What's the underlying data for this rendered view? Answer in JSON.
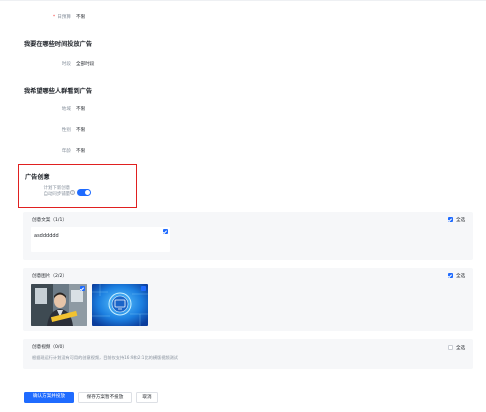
{
  "budget": {
    "label": "日预算",
    "value": "不限"
  },
  "schedule": {
    "title": "我要在哪些时间投放广告",
    "time_label": "时段",
    "time_value": "全部时段"
  },
  "audience": {
    "title": "我希望哪些人群看到广告",
    "region_label": "地域",
    "region_value": "不限",
    "gender_label": "性别",
    "gender_value": "不限",
    "age_label": "年龄",
    "age_value": "不限"
  },
  "creative": {
    "title": "广告创意",
    "sync_label_line1": "计划下新创意",
    "sync_label_line2": "自动同步铺量",
    "help_glyph": "?",
    "sync_enabled": true,
    "icons": {
      "help": "question-circle-icon",
      "toggle": "toggle-switch",
      "checkbox": "checkbox-icon",
      "edit": "edit-icon",
      "image_remove": "remove-icon"
    }
  },
  "copy_card": {
    "title": "创意文案（1/1）",
    "select_all": "全选",
    "checked": true,
    "text": "asdddddd"
  },
  "image_card": {
    "title": "创意图片（2/2）",
    "select_all": "全选",
    "checked": true,
    "images": [
      {
        "name": "photo-person-image"
      },
      {
        "name": "tech-blue-image"
      }
    ]
  },
  "video_card": {
    "title": "创意视频（0/0）",
    "select_all": "全选",
    "checked": false,
    "description": "根据现运行计划没有可用的创意视频，目前仅支持16:9和2:1比的横版视频测试"
  },
  "actions": {
    "confirm_label": "确认方案并投放",
    "save_label": "保存方案暂不投放",
    "cancel_label": "取消"
  },
  "colors": {
    "primary": "#1f6bff",
    "highlight_border": "#e02020",
    "required": "#f53f3f",
    "card_bg": "#f6f7f9"
  }
}
